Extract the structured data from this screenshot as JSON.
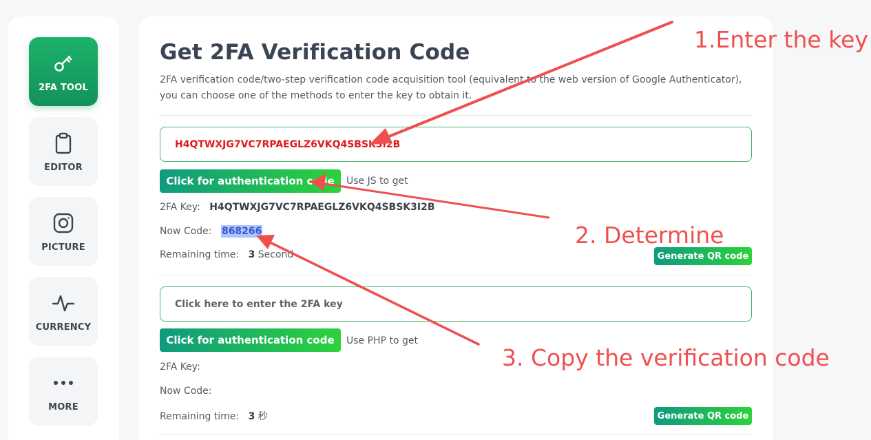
{
  "sidebar": {
    "items": [
      {
        "label": "2FA TOOL",
        "icon": "key-icon",
        "active": true
      },
      {
        "label": "EDITOR",
        "icon": "clipboard-icon",
        "active": false
      },
      {
        "label": "PICTURE",
        "icon": "instagram-icon",
        "active": false
      },
      {
        "label": "CURRENCY",
        "icon": "pulse-icon",
        "active": false
      },
      {
        "label": "MORE",
        "icon": "more-dots-icon",
        "active": false
      }
    ]
  },
  "main": {
    "title": "Get 2FA Verification Code",
    "description": "2FA verification code/two-step verification code acquisition tool (equivalent to the web version of Google Authenticator), you can choose one of the methods to enter the key to obtain it.",
    "js_section": {
      "key_value": "H4QTWXJG7VC7RPAEGLZ6VKQ4SBSK3I2B",
      "button_label": "Click for authentication code",
      "button_note": "Use JS to get",
      "key_label": "2FA Key:",
      "key_display": "H4QTWXJG7VC7RPAEGLZ6VKQ4SBSK3I2B",
      "code_label": "Now Code:",
      "code_value": "868266",
      "time_label": "Remaining time:",
      "time_value": "3",
      "time_unit": "Second",
      "qr_label": "Generate QR code"
    },
    "php_section": {
      "key_placeholder": "Click here to enter the 2FA key",
      "button_label": "Click for authentication code",
      "button_note": "Use PHP to get",
      "key_label": "2FA Key:",
      "code_label": "Now Code:",
      "time_label": "Remaining time:",
      "time_value": "3",
      "time_unit": "秒",
      "qr_label": "Generate QR code"
    }
  },
  "annotations": {
    "step1": "1.Enter the key",
    "step2": "2. Determine",
    "step3": "3. Copy the verification code",
    "color": "#ef4f4f"
  },
  "colors": {
    "accent_green": "#1db26a",
    "key_text_red": "#e01a1a",
    "code_highlight": "#aac6fb"
  }
}
